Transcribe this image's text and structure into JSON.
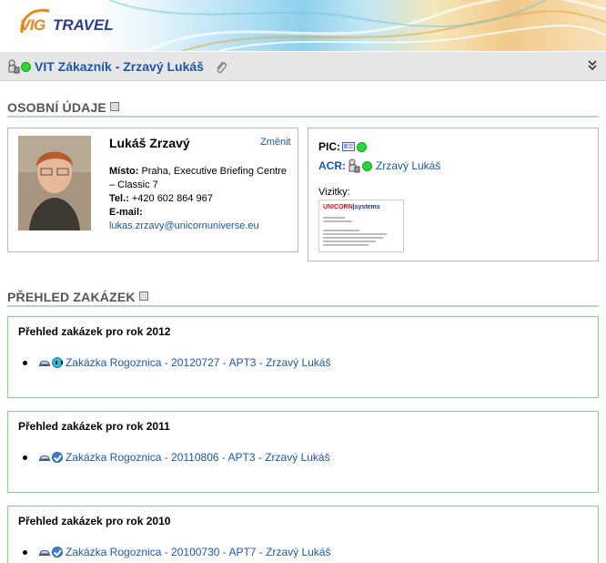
{
  "brand": {
    "logo_vig": "VIG",
    "logo_travel": "TRAVEL"
  },
  "header": {
    "title": "VIT Zákazník - Zrzavý Lukáš",
    "icons": [
      "user-role-icon",
      "online-status-icon",
      "attachment-icon",
      "collapse-chevron-icon"
    ]
  },
  "personal": {
    "section_title": "OSOBNÍ ÚDAJE",
    "name": "Lukáš Zrzavý",
    "edit_label": "Změnit",
    "place_label": "Místo:",
    "place_value": "Praha, Executive Briefing Centre – Classic 7",
    "phone_label": "Tel.:",
    "phone_value": "+420 602 864 967",
    "email_label": "E-mail:",
    "email_value": "lukas.zrzavy@unicornuniverse.eu"
  },
  "assignment": {
    "pic_label": "PIC:",
    "acr_label": "ACR:",
    "acr_value": "Zrzavý Lukáš",
    "cards_label": "Vizitky:",
    "card_brand": "UNICORN",
    "card_brand_suffix": "systems"
  },
  "orders": {
    "section_title": "PŘEHLED ZAKÁZEK",
    "years": [
      {
        "title": "Přehled zakázek pro rok 2012",
        "item": "Zakázka Rogoznica - 20120727 - APT3 - Zrzavý Lukáš",
        "state": "in-progress"
      },
      {
        "title": "Přehled zakázek pro rok 2011",
        "item": "Zakázka Rogoznica - 20110806 - APT3 - Zrzavý Lukáš",
        "state": "completed"
      },
      {
        "title": "Přehled zakázek pro rok 2010",
        "item": "Zakázka Rogoznica - 20100730 - APT7 - Zrzavý Lukáš",
        "state": "completed"
      }
    ]
  },
  "colors": {
    "link": "#1c57a8",
    "status_online": "#2fd43a",
    "order_border": "#8fce8f",
    "section_line": "#b7cde5"
  }
}
